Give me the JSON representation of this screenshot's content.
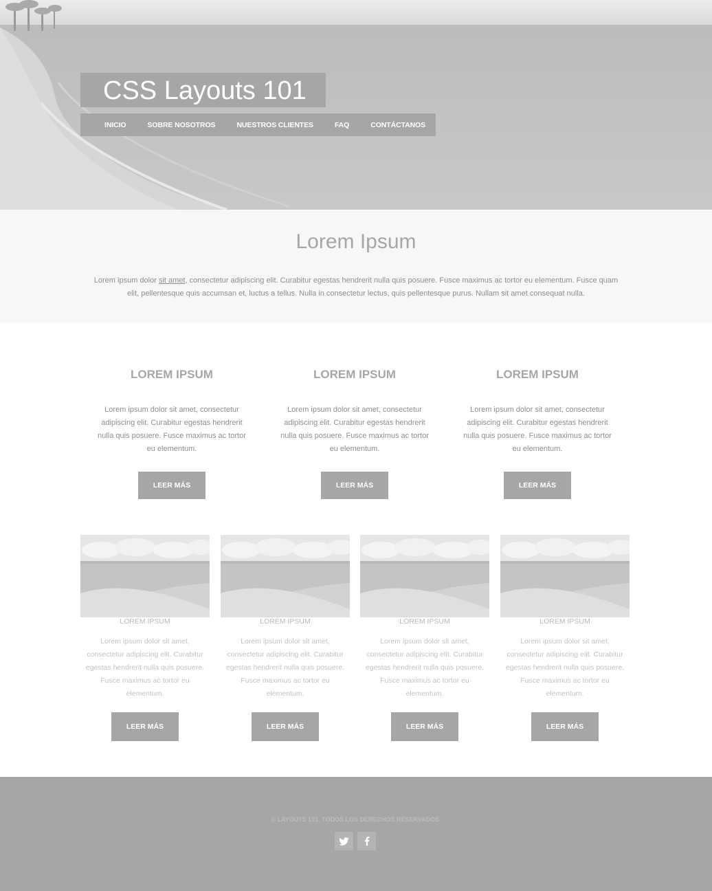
{
  "header": {
    "logo": "CSS Layouts 101",
    "nav": [
      {
        "label": "INICIO"
      },
      {
        "label": "SOBRE NOSOTROS"
      },
      {
        "label": "NUESTROS CLIENTES"
      },
      {
        "label": "FAQ"
      },
      {
        "label": "CONTÁCTANOS"
      }
    ]
  },
  "intro": {
    "title": "Lorem Ipsum",
    "text_before_link": "Lorem ipsum dolor ",
    "link": "sit amet",
    "text_after_link": ", consectetur adipiscing elit. Curabitur egestas hendrerit nulla quis posuere. Fusce maximus ac tortor eu elementum. Fusce quam elit, pellentesque quis accumsan et, luctus a tellus. Nulla in consectetur lectus, quis pellentesque purus. Nullam sit amet consequat nulla."
  },
  "features": [
    {
      "title": "LOREM IPSUM",
      "text": "Lorem ipsum dolor sit amet, consectetur adipiscing elit. Curabitur egestas hendrerit nulla quis posuere. Fusce maximus ac tortor eu elementum.",
      "button": "LEER MÁS"
    },
    {
      "title": "LOREM IPSUM",
      "text": "Lorem ipsum dolor sit amet, consectetur adipiscing elit. Curabitur egestas hendrerit nulla quis posuere. Fusce maximus ac tortor eu elementum.",
      "button": "LEER MÁS"
    },
    {
      "title": "LOREM IPSUM",
      "text": "Lorem ipsum dolor sit amet, consectetur adipiscing elit. Curabitur egestas hendrerit nulla quis posuere. Fusce maximus ac tortor eu elementum.",
      "button": "LEER MÁS"
    }
  ],
  "cards": [
    {
      "title": "LOREM IPSUM",
      "text": "Lorem ipsum dolor sit amet, consectetur adipiscing elit. Curabitur egestas hendrerit nulla quis posuere. Fusce maximus ac tortor eu elementum.",
      "button": "LEER MÁS"
    },
    {
      "title": "LOREM IPSUM",
      "text": "Lorem ipsum dolor sit amet, consectetur adipiscing elit. Curabitur egestas hendrerit nulla quis posuere. Fusce maximus ac tortor eu elementum.",
      "button": "LEER MÁS"
    },
    {
      "title": "LOREM IPSUM",
      "text": "Lorem ipsum dolor sit amet, consectetur adipiscing elit. Curabitur egestas hendrerit nulla quis posuere. Fusce maximus ac tortor eu elementum.",
      "button": "LEER MÁS"
    },
    {
      "title": "LOREM IPSUM",
      "text": "Lorem ipsum dolor sit amet, consectetur adipiscing elit. Curabitur egestas hendrerit nulla quis posuere. Fusce maximus ac tortor eu elementum.",
      "button": "LEER MÁS"
    }
  ],
  "footer": {
    "copyright": "© LAYOUTS 101. TODOS LOS DERECHOS RESERVADOS.",
    "social": [
      {
        "icon": "twitter-icon"
      },
      {
        "icon": "facebook-icon"
      }
    ]
  },
  "colors": {
    "accent_gray": "#a6a6a6",
    "intro_bg": "#f7f7f7",
    "text_gray": "#8e8e8e",
    "white": "#ffffff"
  }
}
